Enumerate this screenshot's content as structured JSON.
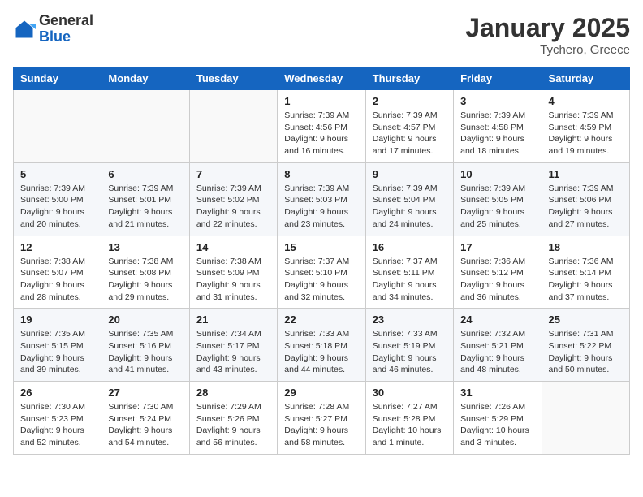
{
  "logo": {
    "general": "General",
    "blue": "Blue"
  },
  "header": {
    "title": "January 2025",
    "subtitle": "Tychero, Greece"
  },
  "days_of_week": [
    "Sunday",
    "Monday",
    "Tuesday",
    "Wednesday",
    "Thursday",
    "Friday",
    "Saturday"
  ],
  "weeks": [
    [
      {
        "day": "",
        "info": ""
      },
      {
        "day": "",
        "info": ""
      },
      {
        "day": "",
        "info": ""
      },
      {
        "day": "1",
        "info": "Sunrise: 7:39 AM\nSunset: 4:56 PM\nDaylight: 9 hours\nand 16 minutes."
      },
      {
        "day": "2",
        "info": "Sunrise: 7:39 AM\nSunset: 4:57 PM\nDaylight: 9 hours\nand 17 minutes."
      },
      {
        "day": "3",
        "info": "Sunrise: 7:39 AM\nSunset: 4:58 PM\nDaylight: 9 hours\nand 18 minutes."
      },
      {
        "day": "4",
        "info": "Sunrise: 7:39 AM\nSunset: 4:59 PM\nDaylight: 9 hours\nand 19 minutes."
      }
    ],
    [
      {
        "day": "5",
        "info": "Sunrise: 7:39 AM\nSunset: 5:00 PM\nDaylight: 9 hours\nand 20 minutes."
      },
      {
        "day": "6",
        "info": "Sunrise: 7:39 AM\nSunset: 5:01 PM\nDaylight: 9 hours\nand 21 minutes."
      },
      {
        "day": "7",
        "info": "Sunrise: 7:39 AM\nSunset: 5:02 PM\nDaylight: 9 hours\nand 22 minutes."
      },
      {
        "day": "8",
        "info": "Sunrise: 7:39 AM\nSunset: 5:03 PM\nDaylight: 9 hours\nand 23 minutes."
      },
      {
        "day": "9",
        "info": "Sunrise: 7:39 AM\nSunset: 5:04 PM\nDaylight: 9 hours\nand 24 minutes."
      },
      {
        "day": "10",
        "info": "Sunrise: 7:39 AM\nSunset: 5:05 PM\nDaylight: 9 hours\nand 25 minutes."
      },
      {
        "day": "11",
        "info": "Sunrise: 7:39 AM\nSunset: 5:06 PM\nDaylight: 9 hours\nand 27 minutes."
      }
    ],
    [
      {
        "day": "12",
        "info": "Sunrise: 7:38 AM\nSunset: 5:07 PM\nDaylight: 9 hours\nand 28 minutes."
      },
      {
        "day": "13",
        "info": "Sunrise: 7:38 AM\nSunset: 5:08 PM\nDaylight: 9 hours\nand 29 minutes."
      },
      {
        "day": "14",
        "info": "Sunrise: 7:38 AM\nSunset: 5:09 PM\nDaylight: 9 hours\nand 31 minutes."
      },
      {
        "day": "15",
        "info": "Sunrise: 7:37 AM\nSunset: 5:10 PM\nDaylight: 9 hours\nand 32 minutes."
      },
      {
        "day": "16",
        "info": "Sunrise: 7:37 AM\nSunset: 5:11 PM\nDaylight: 9 hours\nand 34 minutes."
      },
      {
        "day": "17",
        "info": "Sunrise: 7:36 AM\nSunset: 5:12 PM\nDaylight: 9 hours\nand 36 minutes."
      },
      {
        "day": "18",
        "info": "Sunrise: 7:36 AM\nSunset: 5:14 PM\nDaylight: 9 hours\nand 37 minutes."
      }
    ],
    [
      {
        "day": "19",
        "info": "Sunrise: 7:35 AM\nSunset: 5:15 PM\nDaylight: 9 hours\nand 39 minutes."
      },
      {
        "day": "20",
        "info": "Sunrise: 7:35 AM\nSunset: 5:16 PM\nDaylight: 9 hours\nand 41 minutes."
      },
      {
        "day": "21",
        "info": "Sunrise: 7:34 AM\nSunset: 5:17 PM\nDaylight: 9 hours\nand 43 minutes."
      },
      {
        "day": "22",
        "info": "Sunrise: 7:33 AM\nSunset: 5:18 PM\nDaylight: 9 hours\nand 44 minutes."
      },
      {
        "day": "23",
        "info": "Sunrise: 7:33 AM\nSunset: 5:19 PM\nDaylight: 9 hours\nand 46 minutes."
      },
      {
        "day": "24",
        "info": "Sunrise: 7:32 AM\nSunset: 5:21 PM\nDaylight: 9 hours\nand 48 minutes."
      },
      {
        "day": "25",
        "info": "Sunrise: 7:31 AM\nSunset: 5:22 PM\nDaylight: 9 hours\nand 50 minutes."
      }
    ],
    [
      {
        "day": "26",
        "info": "Sunrise: 7:30 AM\nSunset: 5:23 PM\nDaylight: 9 hours\nand 52 minutes."
      },
      {
        "day": "27",
        "info": "Sunrise: 7:30 AM\nSunset: 5:24 PM\nDaylight: 9 hours\nand 54 minutes."
      },
      {
        "day": "28",
        "info": "Sunrise: 7:29 AM\nSunset: 5:26 PM\nDaylight: 9 hours\nand 56 minutes."
      },
      {
        "day": "29",
        "info": "Sunrise: 7:28 AM\nSunset: 5:27 PM\nDaylight: 9 hours\nand 58 minutes."
      },
      {
        "day": "30",
        "info": "Sunrise: 7:27 AM\nSunset: 5:28 PM\nDaylight: 10 hours\nand 1 minute."
      },
      {
        "day": "31",
        "info": "Sunrise: 7:26 AM\nSunset: 5:29 PM\nDaylight: 10 hours\nand 3 minutes."
      },
      {
        "day": "",
        "info": ""
      }
    ]
  ]
}
